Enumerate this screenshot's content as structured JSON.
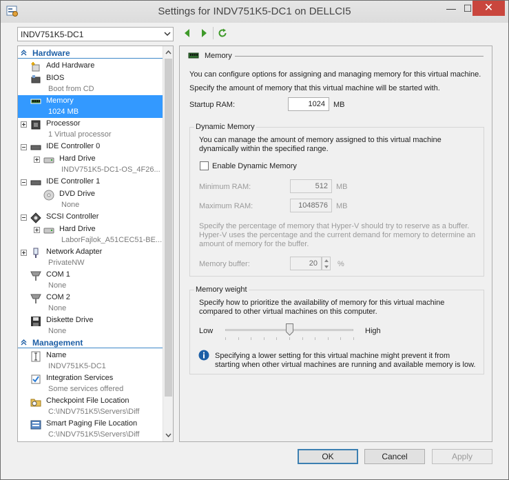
{
  "window": {
    "title": "Settings for INDV751K5-DC1 on DELLCI5",
    "minimize": "—",
    "maximize": "☐",
    "close": "✕"
  },
  "vm_select": {
    "value": "INDV751K5-DC1"
  },
  "tree": {
    "hardware_label": "Hardware",
    "management_label": "Management",
    "hardware_items": [
      {
        "name": "Add Hardware",
        "sub": ""
      },
      {
        "name": "BIOS",
        "sub": "Boot from CD"
      },
      {
        "name": "Memory",
        "sub": "1024 MB"
      },
      {
        "name": "Processor",
        "sub": "1 Virtual processor"
      },
      {
        "name": "IDE Controller 0",
        "sub": ""
      },
      {
        "name": "Hard Drive",
        "sub": "INDV751K5-DC1-OS_4F26..."
      },
      {
        "name": "IDE Controller 1",
        "sub": ""
      },
      {
        "name": "DVD Drive",
        "sub": "None"
      },
      {
        "name": "SCSI Controller",
        "sub": ""
      },
      {
        "name": "Hard Drive",
        "sub": "LaborFajlok_A51CEC51-BE..."
      },
      {
        "name": "Network Adapter",
        "sub": "PrivateNW"
      },
      {
        "name": "COM 1",
        "sub": "None"
      },
      {
        "name": "COM 2",
        "sub": "None"
      },
      {
        "name": "Diskette Drive",
        "sub": "None"
      }
    ],
    "management_items": [
      {
        "name": "Name",
        "sub": "INDV751K5-DC1"
      },
      {
        "name": "Integration Services",
        "sub": "Some services offered"
      },
      {
        "name": "Checkpoint File Location",
        "sub": "C:\\INDV751K5\\Servers\\Diff"
      },
      {
        "name": "Smart Paging File Location",
        "sub": "C:\\INDV751K5\\Servers\\Diff"
      }
    ]
  },
  "panel": {
    "heading": "Memory",
    "intro": "You can configure options for assigning and managing memory for this virtual machine.",
    "startup_desc": "Specify the amount of memory that this virtual machine will be started with.",
    "startup_label": "Startup RAM:",
    "startup_value": "1024",
    "unit_mb": "MB",
    "dynamic": {
      "title": "Dynamic Memory",
      "desc_line1": "You can manage the amount of memory assigned to this virtual machine",
      "desc_line2": "dynamically within the specified range.",
      "enable_label": "Enable Dynamic Memory",
      "min_label": "Minimum RAM:",
      "min_value": "512",
      "max_label": "Maximum RAM:",
      "max_value": "1048576",
      "buffer_desc_line1": "Specify the percentage of memory that Hyper-V should try to reserve as a buffer.",
      "buffer_desc_line2": "Hyper-V uses the percentage and the current demand for memory to determine an",
      "buffer_desc_line3": "amount of memory for the buffer.",
      "buffer_label": "Memory buffer:",
      "buffer_value": "20",
      "unit_pct": "%"
    },
    "weight": {
      "title": "Memory weight",
      "desc_line1": "Specify how to prioritize the availability of memory for this virtual machine",
      "desc_line2": "compared to other virtual machines on this computer.",
      "low_label": "Low",
      "high_label": "High",
      "slider_fraction": 0.5,
      "info_line1": "Specifying a lower setting for this virtual machine might prevent it from",
      "info_line2": "starting when other virtual machines are running and available memory is low."
    }
  },
  "buttons": {
    "ok": "OK",
    "cancel": "Cancel",
    "apply": "Apply"
  },
  "colors": {
    "selection": "#3399ff",
    "section_text": "#1d5fa6",
    "close_button": "#c9463d",
    "info_icon": "#1d5fa6"
  }
}
